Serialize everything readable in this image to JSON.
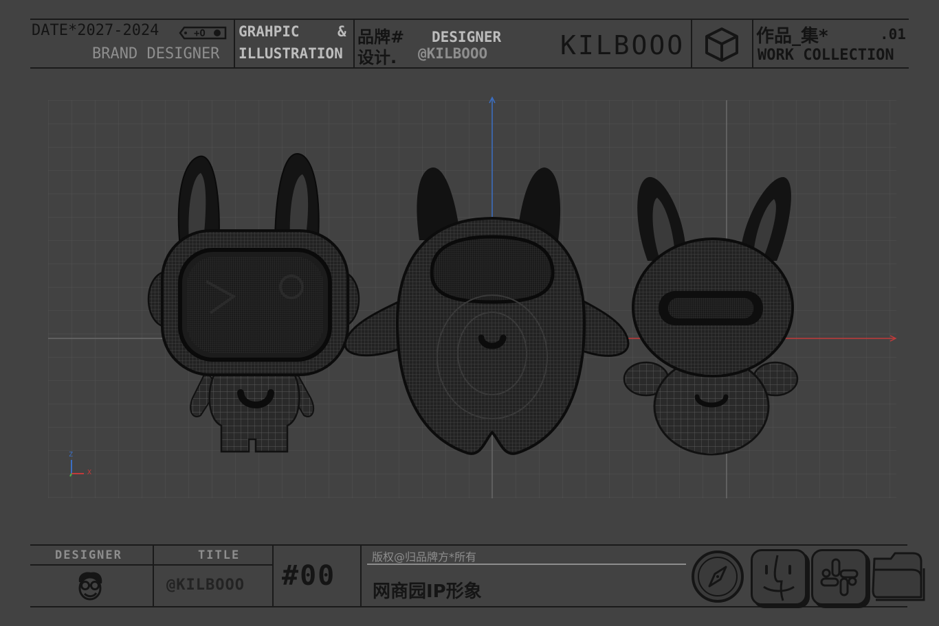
{
  "header": {
    "date": "DATE*2027-2024",
    "brand_designer": "BRAND DESIGNER",
    "graphic": "GRAHPIC",
    "ampersand": "&",
    "illustration": "ILLUSTRATION",
    "brand_cn": "品牌#",
    "design_cn": "设计.",
    "designer": "DESIGNER",
    "handle": "@KILBOOO",
    "logo": "KILBOOO",
    "works_cn": "作品_集*",
    "number": ".01",
    "work_collection": "WORK COLLECTION"
  },
  "viewport": {
    "axis_z": "Z",
    "axis_x": "X",
    "colors": {
      "x_axis": "#c23a3a",
      "y_axis": "#3b6fc4",
      "z_axis": "#3b6fc4",
      "grid": "#565656"
    }
  },
  "footer": {
    "designer_label": "DESIGNER",
    "title_label": "TITLE",
    "handle": "@KILBOOO",
    "number": "#00",
    "copyright": "版权@归品牌方*所有",
    "title": "网商园IP形象"
  }
}
